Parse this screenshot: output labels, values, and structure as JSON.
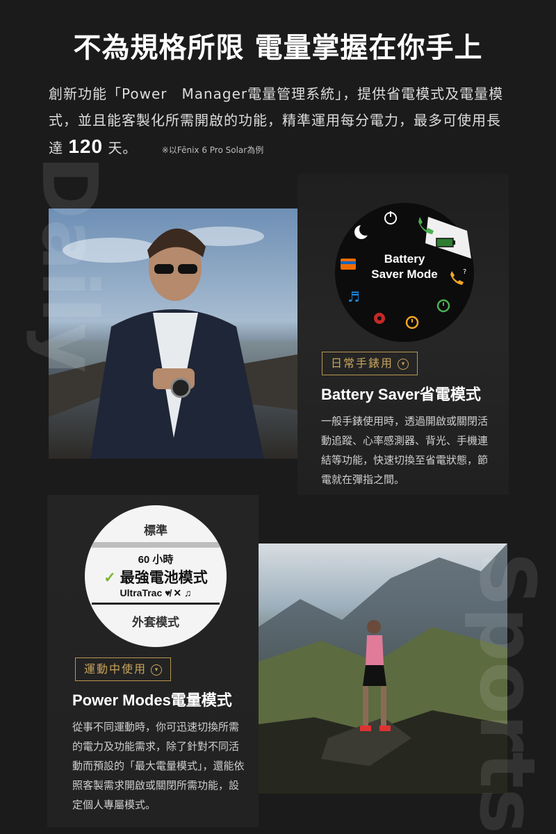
{
  "header": {
    "title": "不為規格所限 電量掌握在你手上",
    "intro_text": "創新功能「Power　Manager電量管理系統」，提供省電模式及電量模式，並且能客製化所需開啟的功能，精準運用每分電力，最多可使用長達",
    "days_value": "120",
    "days_unit": "天。",
    "footnote": "※以Fēnix 6 Pro Solar為例"
  },
  "daily": {
    "watermark": "Daily",
    "watch_center": [
      "Battery",
      "Saver Mode"
    ],
    "icons": [
      "power-icon",
      "phone-bt-icon",
      "battery-icon",
      "phone-question-icon",
      "stopwatch-icon",
      "alarm-icon",
      "stop-button-icon",
      "music-icon",
      "card-icon",
      "moon-icon"
    ],
    "tag": "日常手錶用",
    "heading": "Battery Saver省電模式",
    "body": "一般手錶使用時，透過開啟或關閉活動追蹤、心率感測器、背光、手機連結等功能，快速切換至省電狀態，節電就在彈指之間。"
  },
  "sports": {
    "watermark": "Sports",
    "menu": {
      "standard": "標準",
      "hours": "60 小時",
      "selected": "最強電池模式",
      "ultratrac": "UltraTrac",
      "expedition": "外套模式"
    },
    "tag": "運動中使用",
    "heading": "Power Modes電量模式",
    "body": "從事不同運動時，你可迅速切換所需的電力及功能需求，除了針對不同活動而預設的「最大電量模式」，還能依照客製需求開啟或關閉所需功能，設定個人專屬模式。"
  },
  "colors": {
    "background": "#1b1b1b",
    "accent_gold": "#c8a45c",
    "check_green": "#7bb431"
  }
}
